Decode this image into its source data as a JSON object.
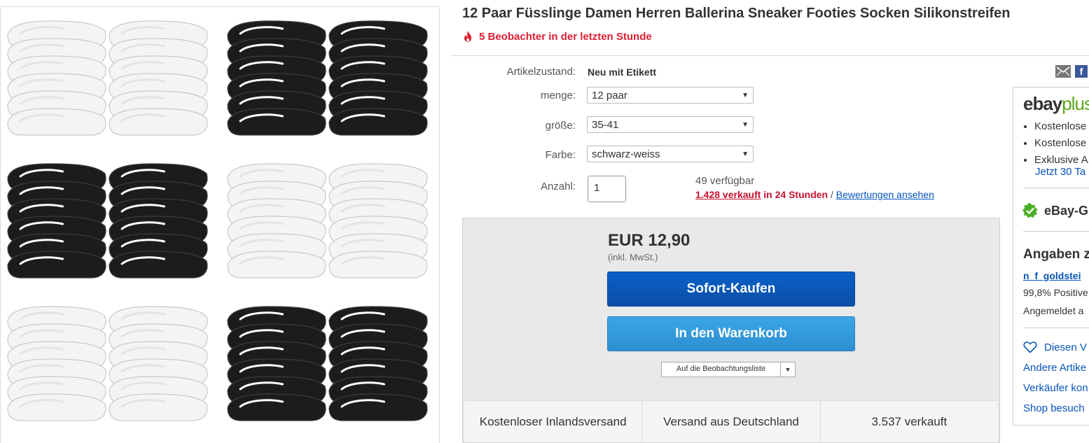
{
  "listing": {
    "title": "12 Paar Füsslinge Damen Herren Ballerina Sneaker Footies Socken Silikonstreifen",
    "watchers": "5 Beobachter in der letzten Stunde",
    "icons": {
      "watchers": "fire-icon"
    }
  },
  "gallery": {
    "packs": [
      "white-socks",
      "black-socks",
      "black-socks",
      "white-socks",
      "white-socks",
      "black-socks"
    ]
  },
  "specifics": {
    "condition_label": "Artikelzustand:",
    "condition_value": "Neu mit Etikett",
    "menge_label": "menge:",
    "menge_value": "12 paar",
    "groesse_label": "größe:",
    "groesse_value": "35-41",
    "farbe_label": "Farbe:",
    "farbe_value": "schwarz-weiss",
    "anzahl_label": "Anzahl:",
    "anzahl_value": "1",
    "available": "49 verfügbar",
    "sold_count": "1.428 verkauft",
    "sold_period": " in 24 Stunden",
    "separator": " / ",
    "reviews_link": "Bewertungen ansehen"
  },
  "buybox": {
    "price": "EUR 12,90",
    "price_note": "(inkl. MwSt.)",
    "buy_now": "Sofort-Kaufen",
    "add_to_cart": "In den Warenkorb",
    "watchlist": "Auf die Beobachtungsliste",
    "shipping": [
      "Kostenloser Inlandsversand",
      "Versand aus Deutschland",
      "3.537 verkauft"
    ]
  },
  "rail": {
    "logo_ebay": "ebay",
    "logo_plus": "plus",
    "benefits": [
      "Kostenlose",
      "Kostenlose",
      "Exklusive A"
    ],
    "trial_link": "Jetzt 30 Ta",
    "guarantee": "eBay-G",
    "seller_heading": "Angaben z",
    "seller_name": "n_f_goldstei",
    "seller_feedback": "99,8% Positive",
    "seller_since": "Angemeldet a",
    "save_seller": "Diesen V",
    "other_items": "Andere Artike",
    "contact_seller": "Verkäufer kon",
    "visit_shop": "Shop besuch",
    "fb_letter": "f"
  },
  "colors": {
    "title": "#333333",
    "watchers": "#dd1e31",
    "buy_now": "#0a54b4",
    "add_to_cart": "#3399dd",
    "link": "#0654ba",
    "plus_green": "#5ba71b"
  }
}
